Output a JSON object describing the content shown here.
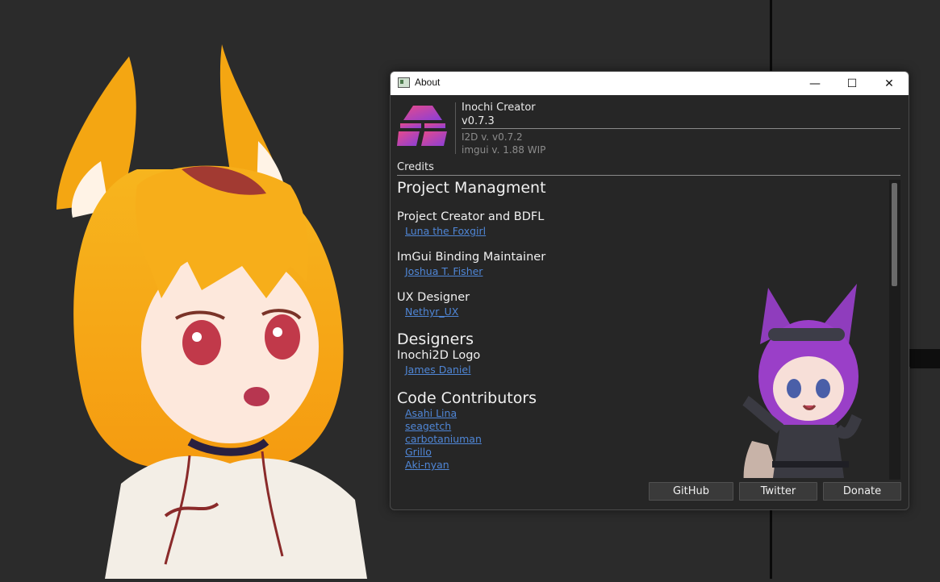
{
  "window": {
    "title": "About",
    "controls": {
      "minimize": "—",
      "maximize": "☐",
      "close": "✕"
    }
  },
  "header": {
    "app_name": "Inochi Creator",
    "app_version": "v0.7.3",
    "i2d_version": "I2D v. v0.7.2",
    "imgui_version": "imgui v. 1.88 WIP"
  },
  "credits": {
    "label": "Credits",
    "sections": {
      "project_management": "Project Managment",
      "creator_title": "Project Creator and BDFL",
      "creator_name": "Luna the Foxgirl",
      "imgui_title": "ImGui Binding Maintainer",
      "imgui_name": "Joshua T. Fisher",
      "ux_title": "UX Designer",
      "ux_name": "Nethyr_UX",
      "designers": "Designers",
      "logo_title": "Inochi2D Logo",
      "logo_name": "James Daniel",
      "code_contributors": "Code Contributors",
      "contributors": [
        "Asahi Lina",
        "seagetch",
        "carbotaniuman",
        "Grillo",
        "Aki-nyan"
      ]
    }
  },
  "buttons": {
    "github": "GitHub",
    "twitter": "Twitter",
    "donate": "Donate"
  },
  "icons": {
    "app_icon": "window-app-icon",
    "logo": "inochi-creator-logo",
    "minimize": "minimize-icon",
    "maximize": "maximize-icon",
    "close": "close-icon"
  },
  "colors": {
    "background": "#2b2b2b",
    "window_bg": "#262626",
    "link": "#4f86d6",
    "logo_gradient": [
      "#e64a8b",
      "#8a3fd8"
    ]
  }
}
